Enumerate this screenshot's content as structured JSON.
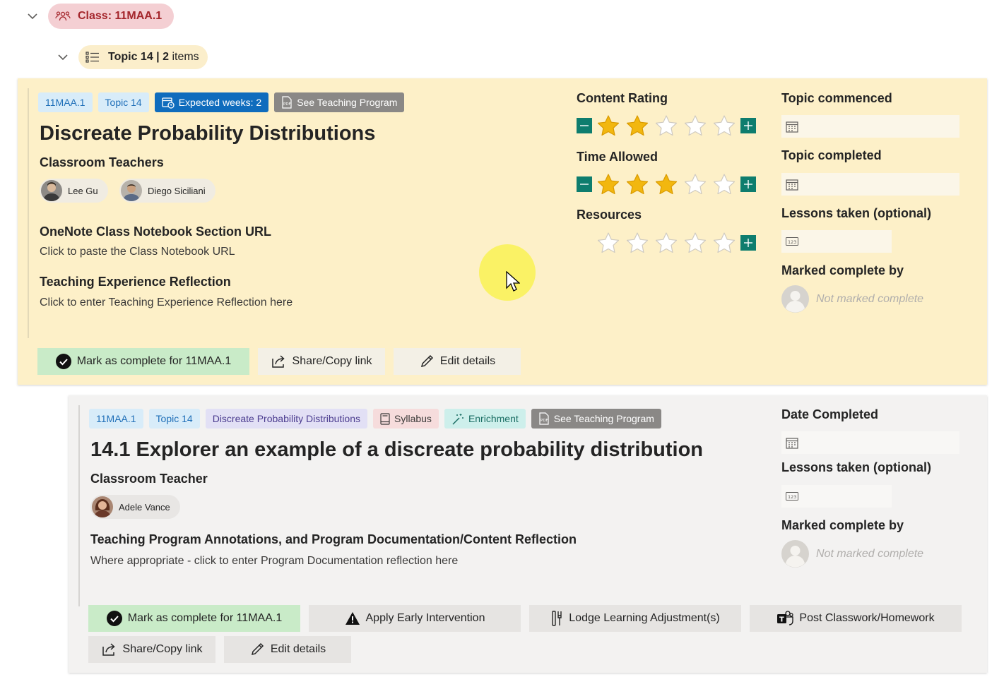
{
  "class_group": {
    "label": "Class: 11MAA.1"
  },
  "topic_group": {
    "topic": "Topic 14 | 2",
    "items_word": "items"
  },
  "topic_card": {
    "tags": {
      "class": "11MAA.1",
      "topic": "Topic 14",
      "expected_weeks": "Expected weeks: 2",
      "teaching_program": "See Teaching Program"
    },
    "title": "Discreate Probability Distributions",
    "teachers_label": "Classroom Teachers",
    "teachers": [
      "Lee Gu",
      "Diego Siciliani"
    ],
    "onenote_label": "OneNote Class Notebook Section URL",
    "onenote_placeholder": "Click to paste the Class Notebook URL",
    "reflection_label": "Teaching Experience Reflection",
    "reflection_placeholder": "Click to enter Teaching Experience Reflection here",
    "ratings": [
      {
        "label": "Content Rating",
        "value": 2,
        "max": 5,
        "has_minus": true
      },
      {
        "label": "Time Allowed",
        "value": 3,
        "max": 5,
        "has_minus": true
      },
      {
        "label": "Resources",
        "value": 0,
        "max": 5,
        "has_minus": false
      }
    ],
    "topic_commenced_label": "Topic commenced",
    "topic_completed_label": "Topic completed",
    "lessons_label": "Lessons taken (optional)",
    "marked_by_label": "Marked complete by",
    "not_marked": "Not marked complete",
    "buttons": {
      "mark_complete": "Mark as complete for 11MAA.1",
      "share": "Share/Copy link",
      "edit": "Edit details"
    }
  },
  "item_card": {
    "tags": {
      "class": "11MAA.1",
      "topic": "Topic 14",
      "topic_name": "Discreate Probability Distributions",
      "syllabus": "Syllabus",
      "enrichment": "Enrichment",
      "teaching_program": "See Teaching Program"
    },
    "title": "14.1 Explorer an example of a discreate probability distribution",
    "teacher_label": "Classroom Teacher",
    "teacher": "Adele Vance",
    "annotations_label": "Teaching Program Annotations, and Program Documentation/Content Reflection",
    "annotations_placeholder": "Where appropriate - click to enter Program Documentation reflection here",
    "date_completed_label": "Date Completed",
    "lessons_label": "Lessons taken (optional)",
    "marked_by_label": "Marked complete by",
    "not_marked": "Not marked complete",
    "buttons": {
      "mark_complete": "Mark as complete for 11MAA.1",
      "early_intervention": "Apply Early Intervention",
      "learning_adjustment": "Lodge Learning Adjustment(s)",
      "post_classwork": "Post Classwork/Homework",
      "share": "Share/Copy link",
      "edit": "Edit details"
    }
  },
  "colors": {
    "accent_teal": "#0e7d6e",
    "star_gold": "#f2b70f",
    "topic_card_bg": "#fdf0c8",
    "item_card_bg": "#f3f2f1",
    "complete_green": "#c9ebc8",
    "class_pill": "#f4cfd3"
  }
}
